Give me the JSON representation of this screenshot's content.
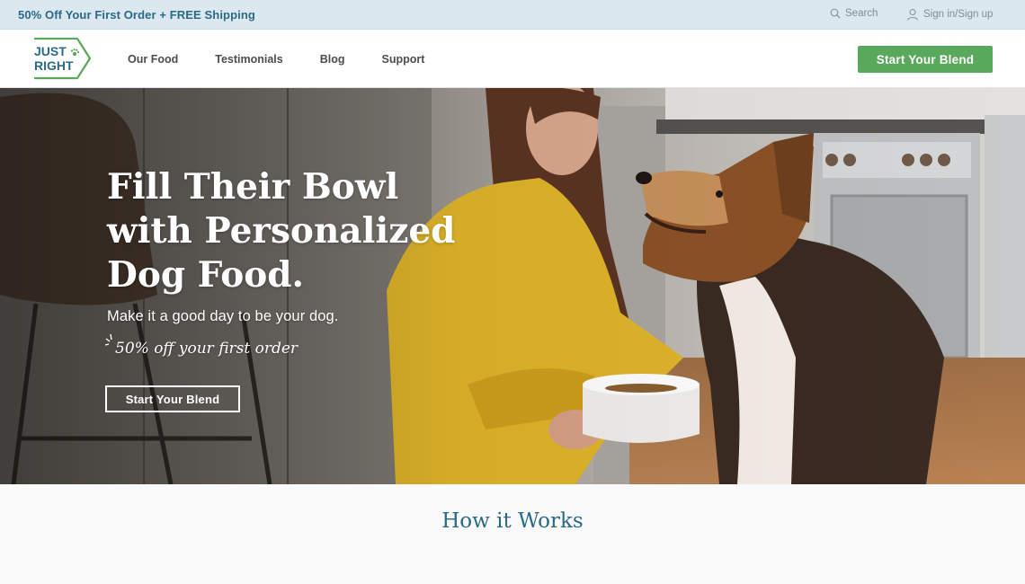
{
  "announcement": {
    "promo_text": "50% Off Your First Order + FREE Shipping",
    "search_label": "Search",
    "account_label": "Sign in/Sign up"
  },
  "header": {
    "logo_text_top": "JUST",
    "logo_text_bottom": "RIGHT",
    "nav_items": [
      "Our Food",
      "Testimonials",
      "Blog",
      "Support"
    ],
    "cta_label": "Start Your Blend"
  },
  "hero": {
    "title": "Fill Their Bowl with Personalized Dog Food.",
    "subtitle": "Make it a good day to be your dog.",
    "offer": "50% off your first order",
    "cta_label": "Start Your Blend"
  },
  "how_it_works": {
    "heading": "How it Works"
  },
  "colors": {
    "brand_teal": "#2b6a86",
    "cta_green": "#5aa85b",
    "topbar_bg": "#dbe8f0"
  },
  "icons": {
    "search": "search-icon",
    "account": "user-icon",
    "logo_paw": "paw-icon"
  }
}
